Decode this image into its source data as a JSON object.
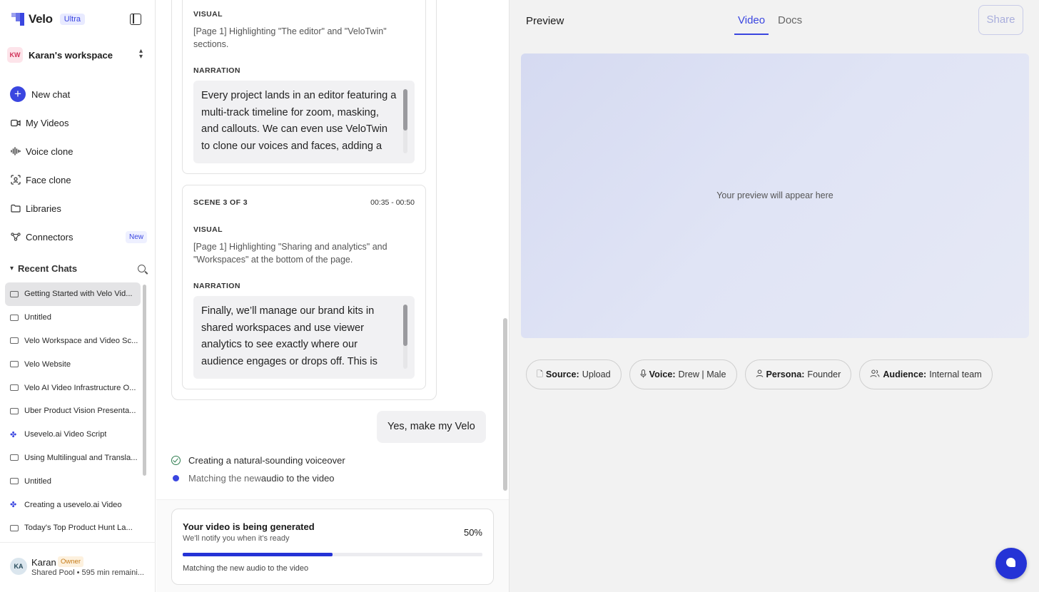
{
  "sidebar": {
    "brand": "Velo",
    "plan": "Ultra",
    "workspace": {
      "initials": "KW",
      "name": "Karan's workspace"
    },
    "nav": {
      "new_chat": "New chat",
      "my_videos": "My Videos",
      "voice_clone": "Voice clone",
      "face_clone": "Face clone",
      "libraries": "Libraries",
      "connectors": "Connectors",
      "connectors_badge": "New"
    },
    "recent_title": "Recent Chats",
    "recent_chats": [
      "Getting Started with Velo Vid...",
      "Untitled",
      "Velo Workspace and Video Sc...",
      "Velo Website",
      "Velo AI Video Infrastructure O...",
      "Uber Product Vision Presenta...",
      "Usevelo.ai Video Script",
      "Using Multilingual and Transla...",
      "Untitled",
      "Creating a usevelo.ai Video",
      "Today's Top Product Hunt La..."
    ],
    "user": {
      "initials": "KA",
      "name": "Karan",
      "role": "Owner",
      "sub": "Shared Pool • 595 min remaini..."
    }
  },
  "chat": {
    "scene2": {
      "visual_label": "VISUAL",
      "visual_text": "[Page 1] Highlighting \"The editor\" and \"VeloTwin\" sections.",
      "narration_label": "NARRATION",
      "narration_text": "Every project lands in an editor featuring a multi-track timeline for zoom, masking, and callouts. We can even use VeloTwin to clone our voices and faces, adding a"
    },
    "scene3": {
      "title": "SCENE 3 OF 3",
      "time": "00:35 - 00:50",
      "visual_label": "VISUAL",
      "visual_text": "[Page 1] Highlighting \"Sharing and analytics\" and \"Workspaces\" at the bottom of the page.",
      "narration_label": "NARRATION",
      "narration_text": "Finally, we’ll manage our brand kits in shared workspaces and use viewer analytics to see exactly where our audience engages or drops off. This is"
    },
    "user_message": "Yes, make my Velo",
    "steps": {
      "done": "Creating a natural-sounding voiceover",
      "active_a": "Matching the new",
      "active_b": " audio to the video"
    },
    "generation": {
      "title": "Your video is being generated",
      "subtitle": "We'll notify you when it's ready",
      "percent_label": "50%",
      "progress": 0.5,
      "status": "Matching the new audio to the video"
    }
  },
  "preview": {
    "title": "Preview",
    "tabs": [
      "Video",
      "Docs"
    ],
    "active_tab": "Video",
    "share": "Share",
    "placeholder": "Your preview will appear here",
    "chips": [
      {
        "icon": "file-icon",
        "label": "Source:",
        "value": "Upload"
      },
      {
        "icon": "mic-icon",
        "label": "Voice:",
        "value": "Drew | Male"
      },
      {
        "icon": "person-icon",
        "label": "Persona:",
        "value": "Founder"
      },
      {
        "icon": "people-icon",
        "label": "Audience:",
        "value": "Internal team"
      }
    ]
  },
  "colors": {
    "accent": "#3a46e0",
    "progress": "#2533d6",
    "success": "#2e7d4f"
  }
}
